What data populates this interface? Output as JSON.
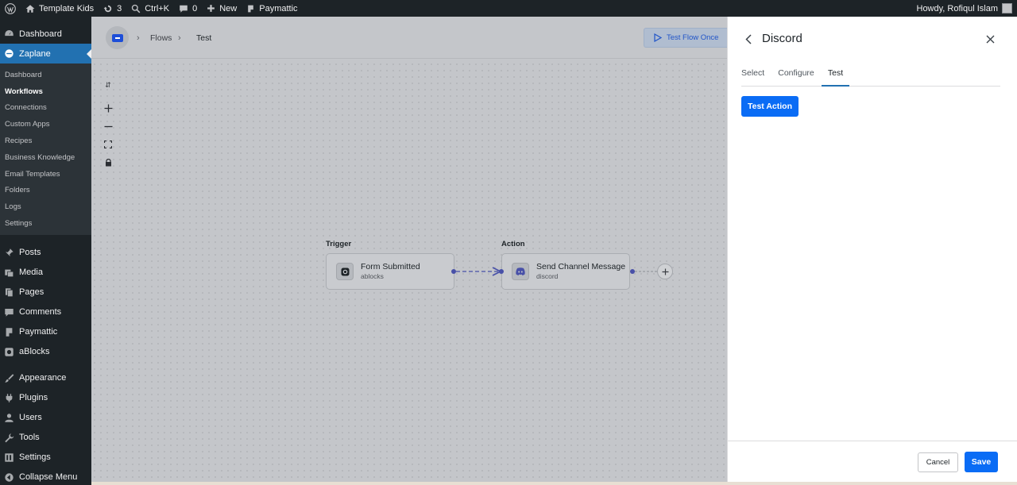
{
  "adminbar": {
    "site_name": "Template Kids",
    "updates_count": "3",
    "search_shortcut": "Ctrl+K",
    "comments_count": "0",
    "new_label": "New",
    "paymattic_label": "Paymattic",
    "howdy": "Howdy, Rofiqul Islam"
  },
  "sidebar": {
    "dashboard": "Dashboard",
    "zaplane": "Zaplane",
    "submenu": [
      "Dashboard",
      "Workflows",
      "Connections",
      "Custom Apps",
      "Recipes",
      "Business Knowledge",
      "Email Templates",
      "Folders",
      "Logs",
      "Settings"
    ],
    "posts": "Posts",
    "media": "Media",
    "pages": "Pages",
    "comments": "Comments",
    "paymattic": "Paymattic",
    "ablocks": "aBlocks",
    "appearance": "Appearance",
    "plugins": "Plugins",
    "users": "Users",
    "tools": "Tools",
    "settings": "Settings",
    "collapse": "Collapse Menu"
  },
  "breadcrumb": {
    "flows": "Flows",
    "current": "Test"
  },
  "toolbar": {
    "test_flow_once": "Test Flow Once"
  },
  "flow": {
    "trigger_label": "Trigger",
    "action_label": "Action",
    "trigger_node": {
      "title": "Form Submitted",
      "subtitle": "ablocks"
    },
    "action_node": {
      "title": "Send Channel Message",
      "subtitle": "discord"
    }
  },
  "panel": {
    "title": "Discord",
    "tabs": [
      "Select",
      "Configure",
      "Test"
    ],
    "active_tab": "Test",
    "test_action": "Test Action",
    "cancel": "Cancel",
    "save": "Save"
  },
  "colors": {
    "primary": "#0a6cf5",
    "wp_dark": "#1d2327",
    "wp_active": "#2271b1",
    "edge": "#4850a8"
  }
}
